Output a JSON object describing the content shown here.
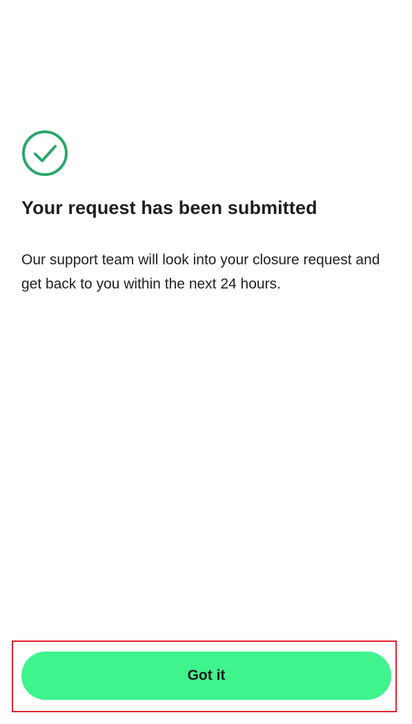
{
  "confirmation": {
    "icon": "check-circle-icon",
    "title": "Your request has been submitted",
    "body": "Our support team will look into your closure request and get back to you within the next 24 hours."
  },
  "actions": {
    "got_it_label": "Got it"
  },
  "colors": {
    "accent_green": "#3ff38d",
    "icon_green": "#2aa66a",
    "highlight_red": "#e0202c",
    "text": "#1f1f1f",
    "background": "#ffffff"
  }
}
